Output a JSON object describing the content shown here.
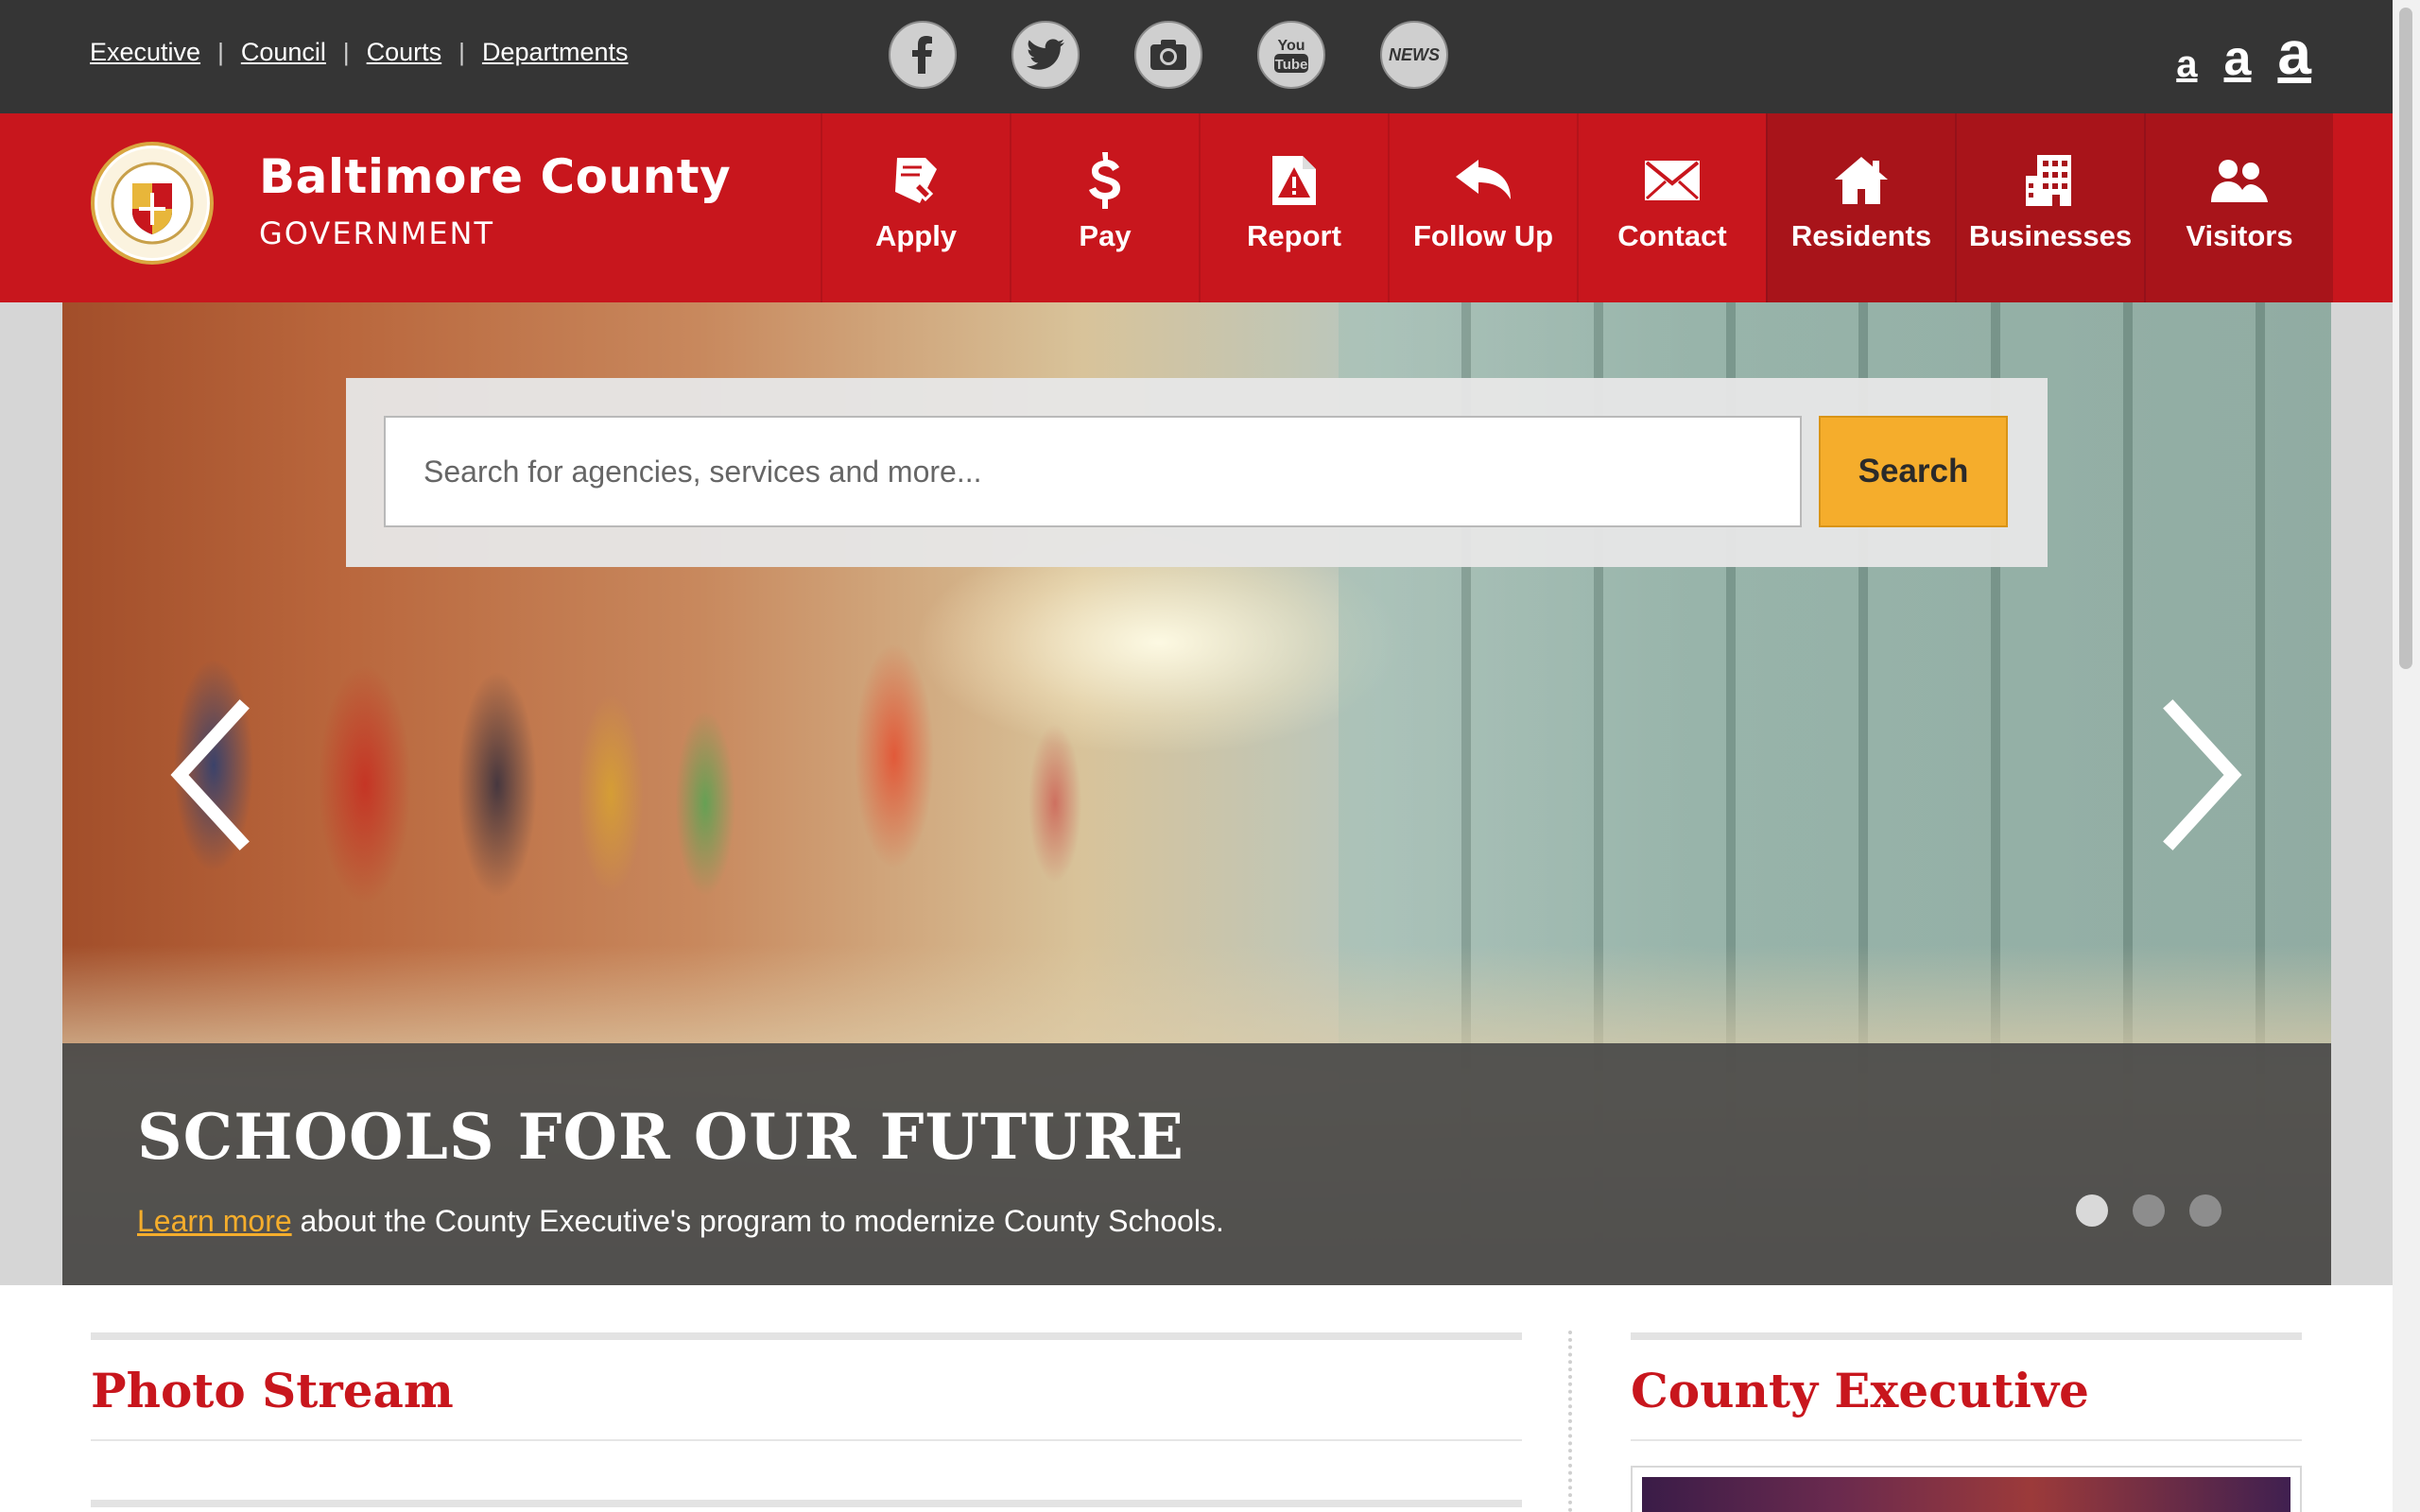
{
  "util_nav": {
    "links": [
      "Executive",
      "Council",
      "Courts",
      "Departments"
    ],
    "separator": "|"
  },
  "social": {
    "icons": [
      "facebook-icon",
      "twitter-icon",
      "instagram-icon",
      "youtube-icon",
      "news-icon"
    ],
    "news_label": "NEWS",
    "youtube_label_top": "You",
    "youtube_label_bottom": "Tube"
  },
  "text_size": {
    "small": "a",
    "medium": "a",
    "large": "a"
  },
  "brand": {
    "title": "Baltimore County",
    "subtitle": "GOVERNMENT"
  },
  "nav": {
    "items": [
      {
        "label": "Apply",
        "icon": "apply-icon"
      },
      {
        "label": "Pay",
        "icon": "dollar-icon"
      },
      {
        "label": "Report",
        "icon": "report-icon"
      },
      {
        "label": "Follow Up",
        "icon": "reply-arrow-icon"
      },
      {
        "label": "Contact",
        "icon": "envelope-icon"
      },
      {
        "label": "Residents",
        "icon": "house-icon"
      },
      {
        "label": "Businesses",
        "icon": "building-icon"
      },
      {
        "label": "Visitors",
        "icon": "people-icon"
      }
    ]
  },
  "search": {
    "placeholder": "Search for agencies, services and more...",
    "button_label": "Search"
  },
  "hero": {
    "title": "SCHOOLS FOR OUR FUTURE",
    "link_text": "Learn more",
    "text": " about the County Executive's program to modernize County Schools.",
    "slide_count": 3,
    "active_slide": 1
  },
  "sections": {
    "left_title": "Photo Stream",
    "right_title": "County Executive"
  },
  "colors": {
    "brand_red": "#c8161d",
    "dark_bar": "#353535",
    "accent_orange": "#f5ad2c"
  }
}
